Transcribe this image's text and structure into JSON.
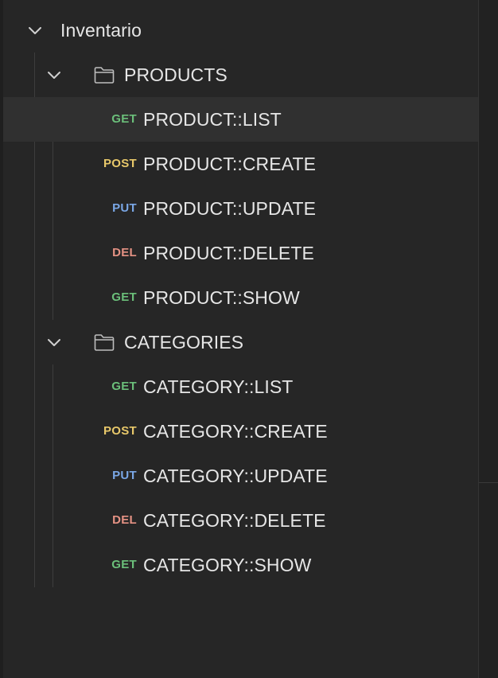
{
  "collection": {
    "name": "Inventario"
  },
  "method_colors": {
    "GET": "#6bbf7a",
    "POST": "#e8c86a",
    "PUT": "#7aa7e6",
    "DEL": "#e59284"
  },
  "folders": [
    {
      "name": "PRODUCTS",
      "requests": [
        {
          "method": "GET",
          "name": "PRODUCT::LIST"
        },
        {
          "method": "POST",
          "name": "PRODUCT::CREATE"
        },
        {
          "method": "PUT",
          "name": "PRODUCT::UPDATE"
        },
        {
          "method": "DEL",
          "name": "PRODUCT::DELETE"
        },
        {
          "method": "GET",
          "name": "PRODUCT::SHOW"
        }
      ]
    },
    {
      "name": "CATEGORIES",
      "requests": [
        {
          "method": "GET",
          "name": "CATEGORY::LIST"
        },
        {
          "method": "POST",
          "name": "CATEGORY::CREATE"
        },
        {
          "method": "PUT",
          "name": "CATEGORY::UPDATE"
        },
        {
          "method": "DEL",
          "name": "CATEGORY::DELETE"
        },
        {
          "method": "GET",
          "name": "CATEGORY::SHOW"
        }
      ]
    }
  ]
}
